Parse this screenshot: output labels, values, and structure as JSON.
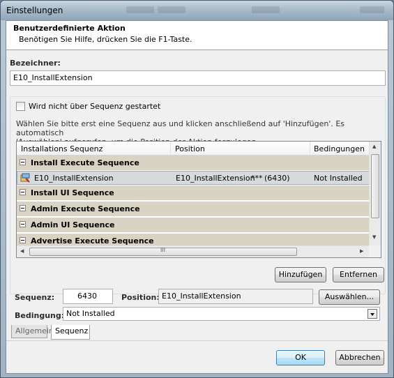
{
  "window": {
    "title": "Einstellungen"
  },
  "header": {
    "title": "Benutzerdefinierte Aktion",
    "subtitle": "Benötigen Sie Hilfe, drücken Sie die F1-Taste."
  },
  "identifier": {
    "label": "Bezeichner:",
    "value": "E10_InstallExtension"
  },
  "sequence_group": {
    "checkbox_label": "Wird nicht über Sequenz gestartet",
    "checkbox_checked": false,
    "info_line1": "Wählen Sie bitte erst eine Sequenz aus und klicken anschließend auf 'Hinzufügen'. Es automatisch",
    "info_line2": "'Auswählen' aufgerufen, um die Position der Aktion feszulegen.",
    "columns": [
      "Installations Sequenz",
      "Position",
      "Bedingungen"
    ],
    "groups": [
      {
        "label": "Install Execute Sequence"
      },
      {
        "label": "Install UI Sequence"
      },
      {
        "label": "Admin Execute Sequence"
      },
      {
        "label": "Admin UI Sequence"
      },
      {
        "label": "Advertise Execute Sequence"
      }
    ],
    "item": {
      "name": "E10_InstallExtension",
      "position": "E10_InstallExtension",
      "marker": "***",
      "number": "(6430)",
      "condition": "Not Installed"
    },
    "scroll_mark": "III",
    "add_button": "Hinzufügen",
    "remove_button": "Entfernen"
  },
  "fields": {
    "sequence_label": "Sequenz:",
    "sequence_value": "6430",
    "position_label": "Position:",
    "position_value": "E10_InstallExtension",
    "select_button": "Auswählen...",
    "condition_label": "Bedingung:",
    "condition_value": "Not Installed"
  },
  "tabs": [
    "Allgemein",
    "Sequenz"
  ],
  "footer": {
    "ok": "OK",
    "cancel": "Abbrechen"
  },
  "colors": {
    "group_row": "#d9d3c4",
    "selected_row": "#d8d9dd",
    "default_button": "#3c7fb1"
  }
}
